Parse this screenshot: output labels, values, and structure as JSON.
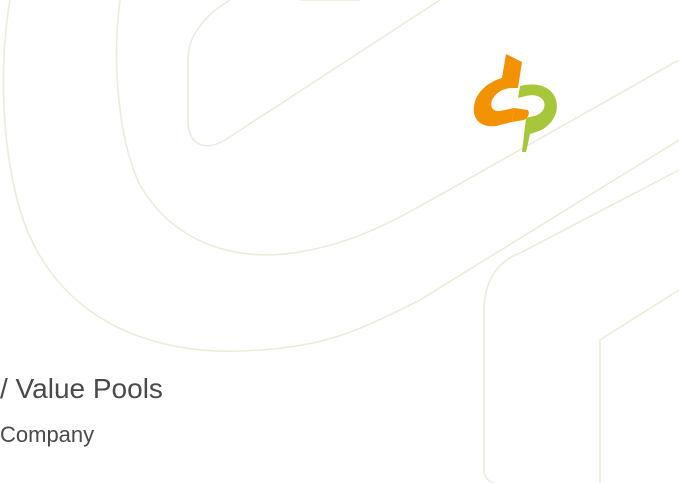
{
  "slide": {
    "title": "/ Value Pools",
    "subtitle": "Company"
  },
  "brand": {
    "logo_icon": "interlocking-s-logo-icon",
    "watermark_icon": "outline-logo-watermark",
    "orange": "#F39200",
    "green": "#A7C63A",
    "watermark_stroke": "#EDEBDD"
  }
}
